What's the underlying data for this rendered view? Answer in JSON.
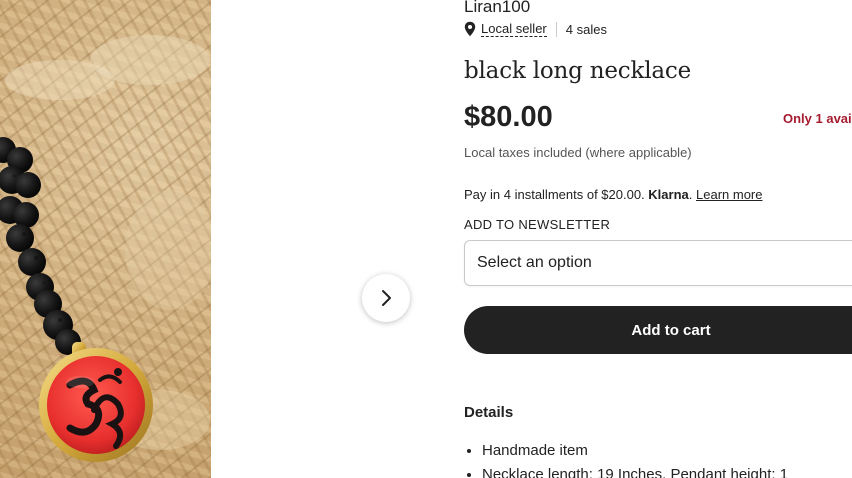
{
  "product_image": {
    "icons": [
      "lava-bead-necklace-photo",
      "om-pendant"
    ]
  },
  "gallery": {
    "next_icon": "chevron-right-icon"
  },
  "shop": {
    "name": "Liran100",
    "local_seller_label": "Local seller",
    "sales": "4 sales",
    "pin_icon": "map-pin-icon"
  },
  "listing": {
    "title": "black long necklace",
    "price": "$80.00",
    "stock_note": "Only 1 avail",
    "taxes_note": "Local taxes included (where applicable)"
  },
  "payment": {
    "installments_text": "Pay in 4 installments of $20.00.",
    "provider": "Klarna",
    "learn_more": "Learn more"
  },
  "variation": {
    "label": "ADD TO NEWSLETTER",
    "placeholder": "Select an option"
  },
  "actions": {
    "add_to_cart": "Add to cart"
  },
  "details": {
    "heading": "Details",
    "items": [
      "Handmade item",
      "Necklace length: 19 Inches, Pendant height: 1"
    ]
  },
  "colors": {
    "price_text": "#222222",
    "stock_warning": "#a61a2e",
    "cart_button_bg": "#222222",
    "cart_button_text": "#ffffff"
  }
}
